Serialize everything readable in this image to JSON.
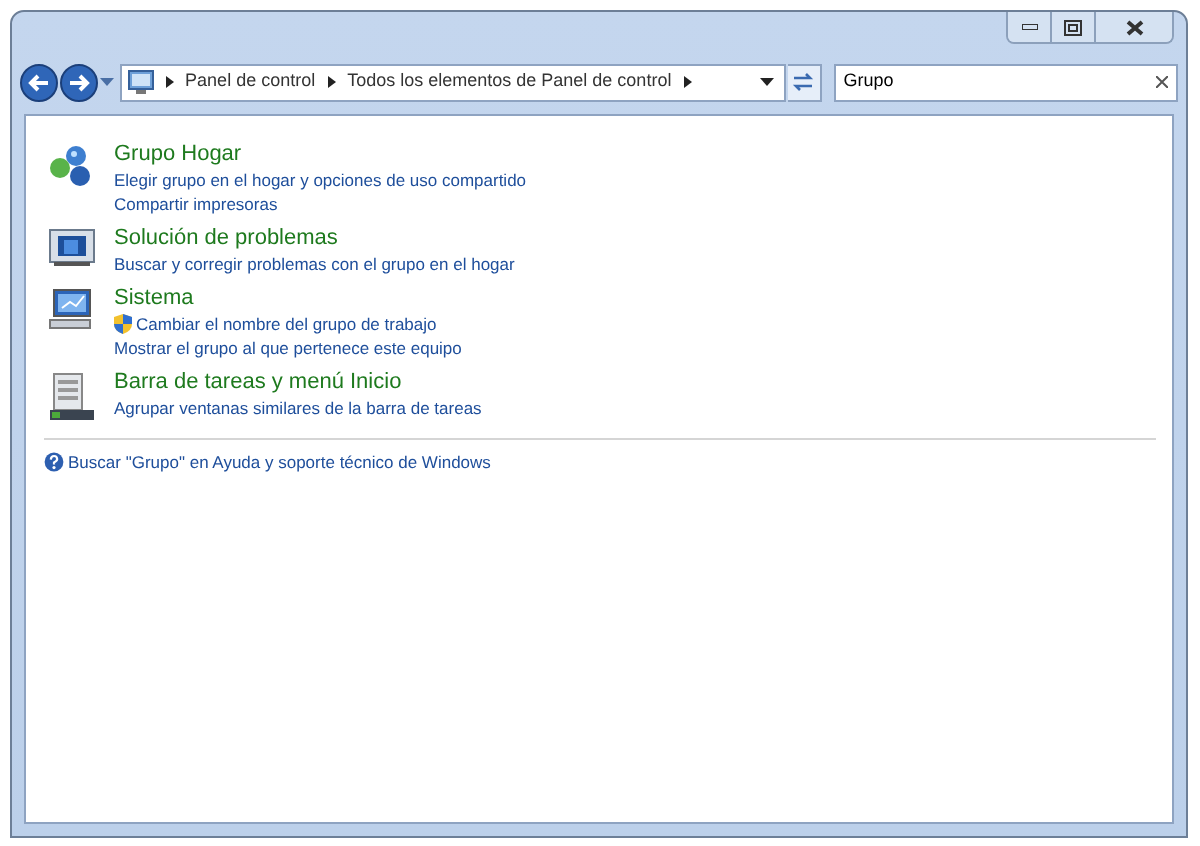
{
  "address_bar": {
    "segments": [
      "Panel de control",
      "Todos los elementos de Panel de control"
    ]
  },
  "search": {
    "value": "Grupo"
  },
  "results": [
    {
      "kind": "network",
      "title": "Grupo Hogar",
      "links": [
        {
          "kind": "plain",
          "text": "Elegir grupo en el hogar y opciones de uso compartido"
        },
        {
          "kind": "plain",
          "text": "Compartir impresoras"
        }
      ]
    },
    {
      "kind": "troubleshoot",
      "title": "Solución de problemas",
      "links": [
        {
          "kind": "plain",
          "text": "Buscar y corregir problemas con el grupo en el hogar"
        }
      ]
    },
    {
      "kind": "computer",
      "title": "Sistema",
      "links": [
        {
          "kind": "shield",
          "text": "Cambiar el nombre del grupo de trabajo"
        },
        {
          "kind": "plain",
          "text": "Mostrar el grupo al que pertenece este equipo"
        }
      ]
    },
    {
      "kind": "taskbar",
      "title": "Barra de tareas y menú Inicio",
      "links": [
        {
          "kind": "plain",
          "text": "Agrupar ventanas similares de la barra de tareas"
        }
      ]
    }
  ],
  "help_link": "Buscar \"Grupo\" en Ayuda y soporte técnico de Windows"
}
